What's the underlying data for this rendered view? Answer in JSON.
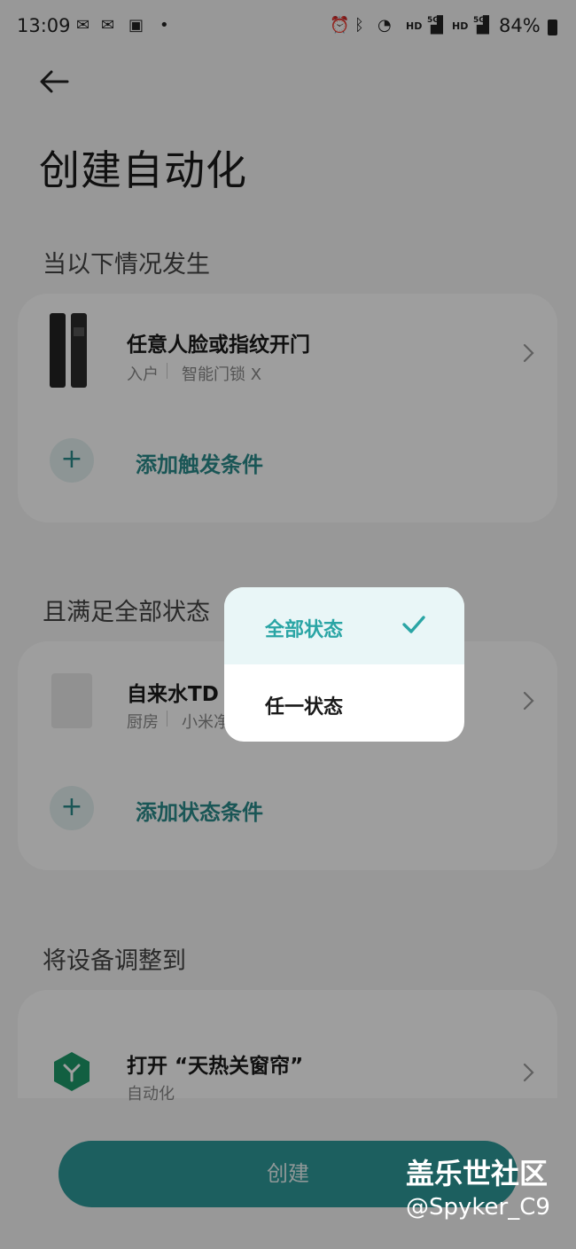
{
  "status_bar": {
    "time": "13:09",
    "left_icons": [
      "wechat-icon",
      "wechat-icon",
      "image-icon",
      "dot-icon"
    ],
    "right_icons": [
      "alarm-icon",
      "bluetooth-icon",
      "wifi-icon",
      "signal-icon",
      "signal-icon"
    ],
    "hd1": "HD",
    "hd2": "HD",
    "net1": "5G",
    "net2": "5G",
    "battery": "84%"
  },
  "page": {
    "title": "创建自动化"
  },
  "trigger_section": {
    "heading": "当以下情况发生",
    "device": {
      "title": "任意人脸或指纹开门",
      "room": "入户",
      "device_name": "智能门锁 X"
    },
    "add_label": "添加触发条件"
  },
  "state_section": {
    "heading": "且满足全部状态",
    "device": {
      "title": "自来水TD",
      "room": "厨房",
      "device_name": "小米净"
    },
    "add_label": "添加状态条件"
  },
  "action_section": {
    "heading": "将设备调整到",
    "item": {
      "title": "打开 “天热关窗帘”",
      "subtitle": "自动化"
    }
  },
  "create_button": {
    "label": "创建"
  },
  "dropdown": {
    "options": [
      {
        "label": "全部状态",
        "selected": true
      },
      {
        "label": "任一状态",
        "selected": false
      }
    ]
  },
  "watermark": {
    "line1": "盖乐世社区",
    "line2": "@Spyker_C9"
  },
  "colors": {
    "accent": "#2aa5a5",
    "button": "#2e9999",
    "selected_bg": "#e9f6f7"
  }
}
